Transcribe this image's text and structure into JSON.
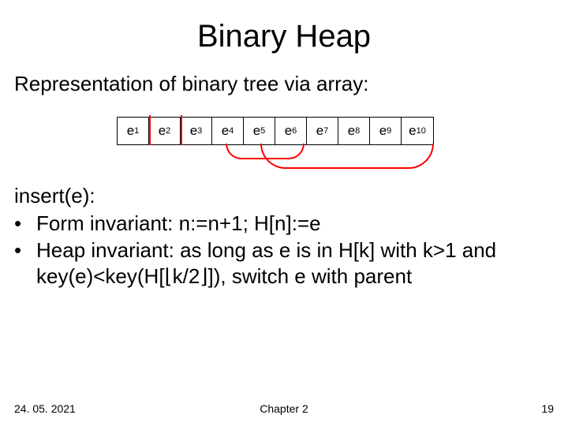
{
  "title": "Binary Heap",
  "subtitle": "Representation of binary tree via array:",
  "cells": {
    "c1": {
      "base": "e",
      "sub": "1"
    },
    "c2": {
      "base": "e",
      "sub": "2"
    },
    "c3": {
      "base": "e",
      "sub": "3"
    },
    "c4": {
      "base": "e",
      "sub": "4"
    },
    "c5": {
      "base": "e",
      "sub": "5"
    },
    "c6": {
      "base": "e",
      "sub": "6"
    },
    "c7": {
      "base": "e",
      "sub": "7"
    },
    "c8": {
      "base": "e",
      "sub": "8"
    },
    "c9": {
      "base": "e",
      "sub": "9"
    },
    "c10": {
      "base": "e",
      "sub": "10"
    }
  },
  "body": {
    "insert_label": "insert(e):",
    "bullet1": "Form invariant: n:=n+1; H[n]:=e",
    "bullet2": "Heap invariant: as long as e is in H[k] with k>1 and key(e)<key(H[⌊k/2⌋]),  switch e with parent"
  },
  "footer": {
    "date": "24. 05. 2021",
    "chapter": "Chapter 2",
    "page": "19"
  }
}
